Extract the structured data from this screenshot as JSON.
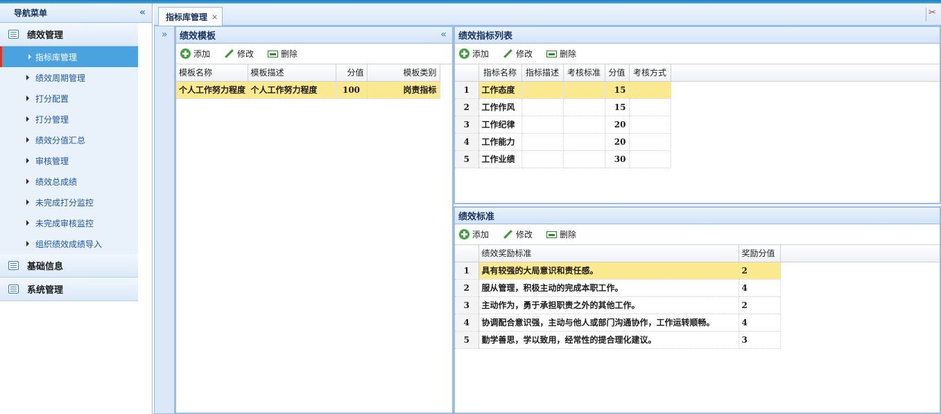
{
  "sidebar": {
    "title": "导航菜单",
    "collapse_icon": "«",
    "groups": [
      {
        "label": "绩效管理",
        "items": [
          "指标库管理",
          "绩效周期管理",
          "打分配置",
          "打分管理",
          "绩效分值汇总",
          "审核管理",
          "绩效总成绩",
          "未完成打分监控",
          "未完成审核监控",
          "组织绩效成绩导入"
        ]
      },
      {
        "label": "基础信息"
      },
      {
        "label": "系统管理"
      }
    ],
    "active_item": "指标库管理"
  },
  "tabs": [
    {
      "label": "指标库管理",
      "close": "×"
    }
  ],
  "collapsed_expand_icon": "»",
  "template_panel": {
    "title": "绩效模板",
    "toolbar": {
      "add": "添加",
      "edit": "修改",
      "delete": "删除"
    },
    "columns": [
      "模板名称",
      "模板描述",
      "分值",
      "模板类别"
    ],
    "rows": [
      {
        "name": "个人工作努力程度",
        "desc": "个人工作努力程度",
        "score": "100",
        "category": "岗责指标"
      }
    ]
  },
  "indicator_panel": {
    "title": "绩效指标列表",
    "toolbar": {
      "add": "添加",
      "edit": "修改",
      "delete": "删除"
    },
    "columns": [
      "指标名称",
      "指标描述",
      "考核标准",
      "分值",
      "考核方式"
    ],
    "rows": [
      {
        "no": "1",
        "name": "工作态度",
        "desc": "",
        "standard": "",
        "score": "15",
        "method": ""
      },
      {
        "no": "2",
        "name": "工作作风",
        "desc": "",
        "standard": "",
        "score": "15",
        "method": ""
      },
      {
        "no": "3",
        "name": "工作纪律",
        "desc": "",
        "standard": "",
        "score": "20",
        "method": ""
      },
      {
        "no": "4",
        "name": "工作能力",
        "desc": "",
        "standard": "",
        "score": "20",
        "method": ""
      },
      {
        "no": "5",
        "name": "工作业绩",
        "desc": "",
        "standard": "",
        "score": "30",
        "method": ""
      }
    ]
  },
  "standard_panel": {
    "title": "绩效标准",
    "toolbar": {
      "add": "添加",
      "edit": "修改",
      "delete": "删除"
    },
    "columns": [
      "绩效奖励标准",
      "奖励分值"
    ],
    "rows": [
      {
        "no": "1",
        "standard": "具有较强的大局意识和责任感。",
        "score": "2"
      },
      {
        "no": "2",
        "standard": "服从管理，积极主动的完成本职工作。",
        "score": "4"
      },
      {
        "no": "3",
        "standard": "主动作为，勇于承担职责之外的其他工作。",
        "score": "2"
      },
      {
        "no": "4",
        "standard": "协调配合意识强，主动与他人或部门沟通协作，工作运转顺畅。",
        "score": "4"
      },
      {
        "no": "5",
        "standard": "勤学善思，学以致用，经常性的提合理化建议。",
        "score": "3"
      }
    ]
  }
}
